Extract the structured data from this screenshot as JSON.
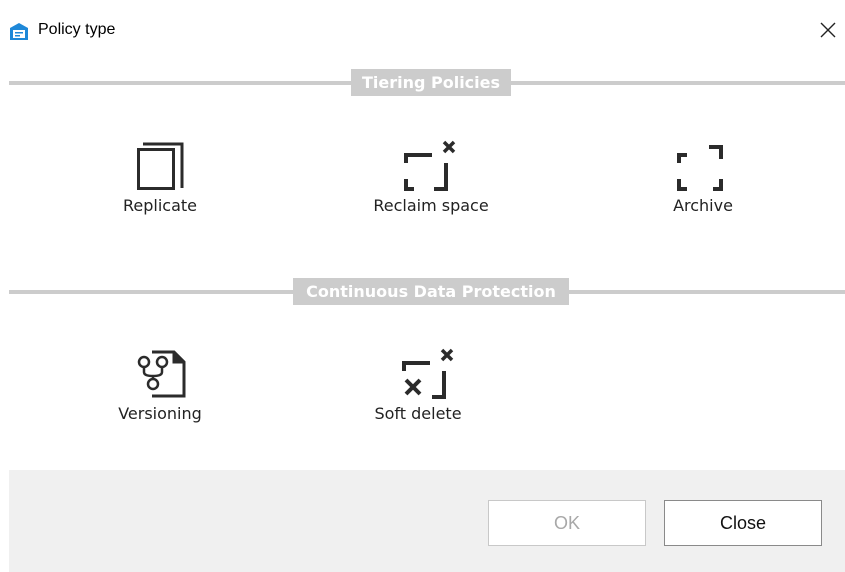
{
  "window": {
    "title": "Policy type",
    "icons": {
      "app": "policy-app-icon",
      "close": "close-icon"
    }
  },
  "sections": [
    {
      "label": "Tiering Policies",
      "items": [
        {
          "label": "Replicate",
          "icon": "replicate-icon"
        },
        {
          "label": "Reclaim space",
          "icon": "reclaim-space-icon"
        },
        {
          "label": "Archive",
          "icon": "archive-icon"
        }
      ]
    },
    {
      "label": "Continuous Data Protection",
      "items": [
        {
          "label": "Versioning",
          "icon": "versioning-icon"
        },
        {
          "label": "Soft delete",
          "icon": "soft-delete-icon"
        }
      ]
    }
  ],
  "footer": {
    "ok_label": "OK",
    "close_label": "Close",
    "ok_enabled": false
  },
  "colors": {
    "section_bar": "#cccccc",
    "footer_bg": "#f0f0f0",
    "icon_dark": "#2b2b2b",
    "app_icon_blue": "#1e88d8"
  }
}
